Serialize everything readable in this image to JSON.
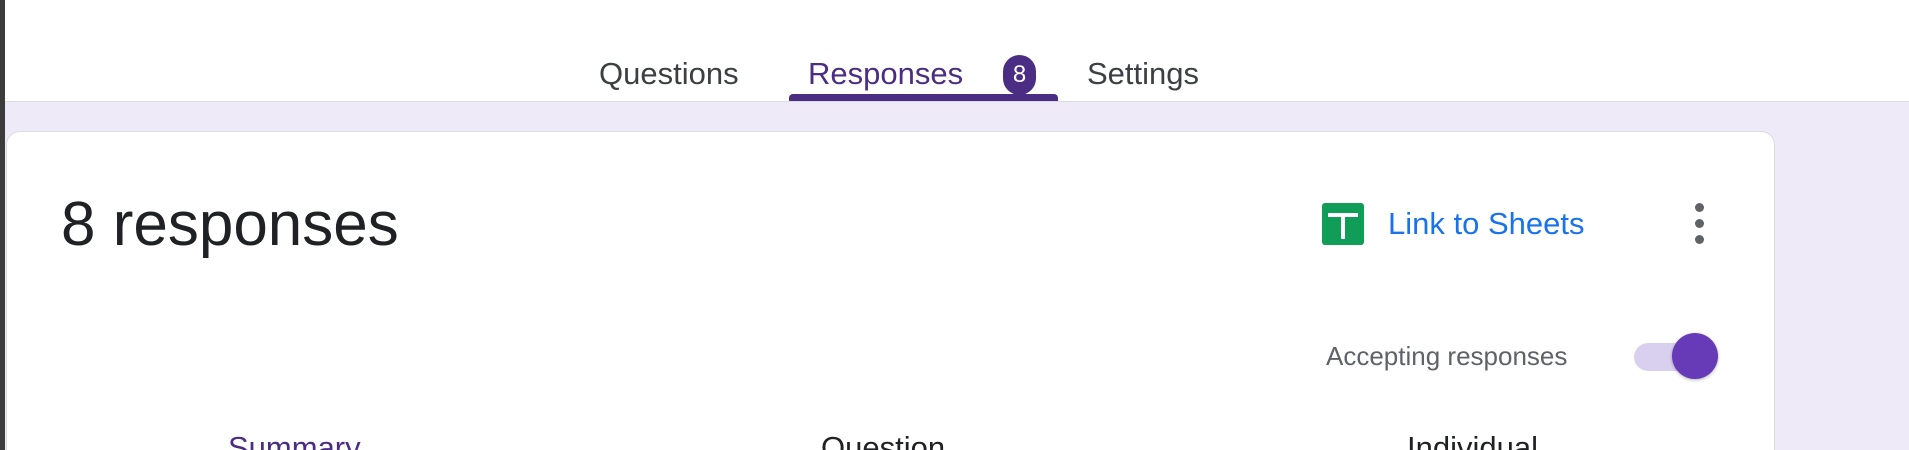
{
  "tabs": {
    "questions": "Questions",
    "responses": "Responses",
    "responses_badge": "8",
    "settings": "Settings"
  },
  "summary": {
    "title": "8 responses",
    "link_to_sheets": "Link to Sheets",
    "more_icon": "more-vert-icon",
    "accepting_label": "Accepting responses",
    "accepting_on": true
  },
  "subtabs": {
    "summary": "Summary",
    "question": "Question",
    "individual": "Individual"
  },
  "colors": {
    "accent": "#4b2e83",
    "toggle": "#673ab7",
    "link": "#1a73e8",
    "sheets": "#0f9d58",
    "background": "#efeaf8"
  }
}
